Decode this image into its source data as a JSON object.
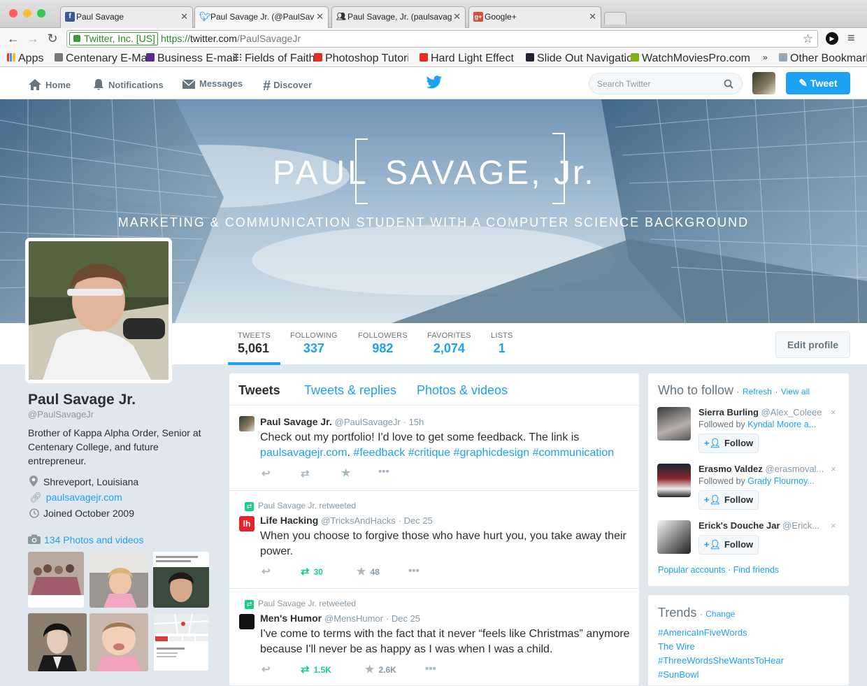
{
  "browser": {
    "tabs": [
      {
        "title": "Paul Savage",
        "favicon": "facebook-icon",
        "color": "#3b5998"
      },
      {
        "title": "Paul Savage Jr. (@PaulSav",
        "favicon": "twitter-icon",
        "color": "#55acee"
      },
      {
        "title": "Paul Savage, Jr. (paulsavag",
        "favicon": "linkedin-group-icon",
        "color": "#333333"
      },
      {
        "title": "Google+",
        "favicon": "google-plus-icon",
        "color": "#dd4b39"
      }
    ],
    "security_label": "Twitter, Inc. [US]",
    "url_scheme": "https://",
    "url_host": "twitter.com",
    "url_path": "/PaulSavageJr",
    "bookmarks": [
      "Apps",
      "Centenary E-Mail",
      "Business E-mail",
      "Fields of Faith",
      "Photoshop Tutorial:",
      "Hard Light Effects in",
      "Slide Out Navigation",
      "WatchMoviesPro.com"
    ],
    "more_bookmarks": "»",
    "other_bookmarks": "Other Bookmarks"
  },
  "nav": {
    "home": "Home",
    "notifications": "Notifications",
    "messages": "Messages",
    "discover": "Discover",
    "search_placeholder": "Search Twitter",
    "tweet_button": "Tweet"
  },
  "banner": {
    "name_left": "PAUL",
    "name_right": "SAVAGE, Jr.",
    "tagline": "MARKETING & COMMUNICATION STUDENT WITH A COMPUTER SCIENCE BACKGROUND"
  },
  "stats": [
    {
      "label": "Tweets",
      "value": "5,061"
    },
    {
      "label": "Following",
      "value": "337"
    },
    {
      "label": "Followers",
      "value": "982"
    },
    {
      "label": "Favorites",
      "value": "2,074"
    },
    {
      "label": "Lists",
      "value": "1"
    }
  ],
  "edit_profile": "Edit profile",
  "profile": {
    "name": "Paul Savage Jr.",
    "handle": "@PaulSavageJr",
    "bio": "Brother of Kappa Alpha Order, Senior at Centenary College, and future entrepreneur.",
    "location": "Shreveport, Louisiana",
    "website": "paulsavagejr.com",
    "joined": "Joined October 2009",
    "photos_link": "134 Photos and videos"
  },
  "timeline_tabs": [
    "Tweets",
    "Tweets & replies",
    "Photos & videos"
  ],
  "tweets": [
    {
      "name": "Paul Savage Jr.",
      "handle": "@PaulSavageJr",
      "time": "· 15h",
      "text_plain": "Check out my portfolio! I'd love to get some feedback. The link is",
      "link": "paulsavagejr.com",
      "dot": ".",
      "tags": "#feedback #critique #graphicdesign #communication"
    },
    {
      "retweeted_by": "Paul Savage Jr. retweeted",
      "name": "Life Hacking",
      "handle": "@TricksAndHacks",
      "time": "· Dec 25",
      "text": "When you choose to forgive those who have hurt you, you take away their power.",
      "retweets": "30",
      "favorites": "48"
    },
    {
      "retweeted_by": "Paul Savage Jr. retweeted",
      "name": "Men's Humor",
      "handle": "@MensHumor",
      "time": "· Dec 25",
      "text": "I've come to terms with the fact that it never “feels like Christmas” anymore because I'll never be as happy as I was when I was a child.",
      "retweets": "1.5K",
      "favorites": "2.6K"
    }
  ],
  "who_to_follow": {
    "title": "Who to follow",
    "refresh": "Refresh",
    "view_all": "View all",
    "sep": "·",
    "follow_label": "Follow",
    "close": "×",
    "people": [
      {
        "name": "Sierra Burling",
        "handle": "@Alex_Coleee",
        "followed_prefix": "Followed by",
        "followed_by": "Kyndal Moore a..."
      },
      {
        "name": "Erasmo Valdez",
        "handle": "@erasmoval...",
        "followed_prefix": "Followed by",
        "followed_by": "Grady Flournoy..."
      },
      {
        "name": "Erick's Douche Jar",
        "handle": "@Erick...",
        "followed_prefix": "",
        "followed_by": ""
      }
    ],
    "popular": "Popular accounts",
    "find_friends": "Find friends"
  },
  "trends": {
    "title": "Trends",
    "sep": "·",
    "change": "Change",
    "items": [
      "#AmericaInFiveWords",
      "The Wire",
      "#ThreeWordsSheWantsToHear",
      "#SunBowl"
    ]
  },
  "colors": {
    "twitter_blue": "#1da1f2",
    "retweet_green": "#19cf86"
  }
}
